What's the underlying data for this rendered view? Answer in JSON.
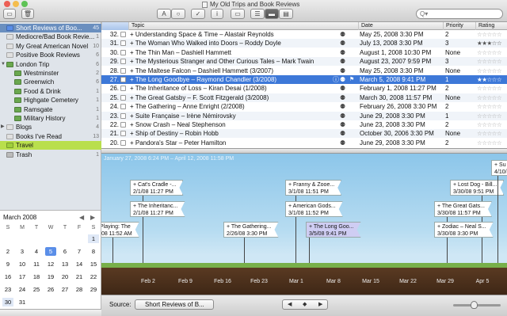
{
  "window": {
    "title": "My Old Trips and Book Reviews",
    "colors": {
      "close": "#ec5f55",
      "minimize": "#f4bd4e",
      "zoom": "#5ec356"
    }
  },
  "toolbar": {
    "text_button": "A",
    "circle_button": "○",
    "check_button": "✓",
    "info_button": "i",
    "search_placeholder": "Q▾"
  },
  "sidebar": {
    "items": [
      {
        "label": "Short Reviews of Boo...",
        "count": "45",
        "selected": true
      },
      {
        "label": "Mediocre/Bad Book Revie...",
        "count": "1"
      },
      {
        "label": "My Great American Novel",
        "count": "10"
      },
      {
        "label": "Positive Book Reviews",
        "count": "6"
      },
      {
        "label": "London Trip",
        "count": "6"
      },
      {
        "label": "Westminster",
        "count": "2"
      },
      {
        "label": "Greenwich",
        "count": "6"
      },
      {
        "label": "Food & Drink",
        "count": "1"
      },
      {
        "label": "Highgate Cemetery",
        "count": "1"
      },
      {
        "label": "Ramsgate",
        "count": "1"
      },
      {
        "label": "Military History",
        "count": "1"
      },
      {
        "label": "Blogs",
        "count": "4"
      },
      {
        "label": "Books I've Read",
        "count": "13"
      },
      {
        "label": "Travel",
        "count": ""
      },
      {
        "label": "Trash",
        "count": "1"
      }
    ]
  },
  "calendar": {
    "title": "March 2008",
    "prev": "◀",
    "next": "▶",
    "weekdays": [
      "S",
      "M",
      "T",
      "W",
      "T",
      "F",
      "S"
    ],
    "weeks": [
      [
        "",
        "",
        "",
        "",
        "",
        "",
        "1"
      ],
      [
        "2",
        "3",
        "4",
        "5",
        "6",
        "7",
        "8"
      ],
      [
        "9",
        "10",
        "11",
        "12",
        "13",
        "14",
        "15"
      ],
      [
        "16",
        "17",
        "18",
        "19",
        "20",
        "21",
        "22"
      ],
      [
        "23",
        "24",
        "25",
        "26",
        "27",
        "28",
        "29"
      ],
      [
        "30",
        "31",
        "",
        "",
        "",
        "",
        ""
      ]
    ],
    "selected_day": "5",
    "highlighted_days": [
      "1",
      "30"
    ]
  },
  "table": {
    "headers": {
      "topic": "Topic",
      "date": "Date",
      "priority": "Priority",
      "rating": "Rating"
    },
    "rows": [
      {
        "num": "32.",
        "topic": "+ Understanding Space & Time – Alastair Reynolds",
        "date": "May 25, 2008 3:30 PM",
        "priority": "2",
        "rating": 0
      },
      {
        "num": "31.",
        "topic": "+ The Woman Who Walked into Doors – Roddy Doyle",
        "date": "July 13, 2008 3:30 PM",
        "priority": "3",
        "rating": 3
      },
      {
        "num": "30.",
        "topic": "+ The Thin Man – Dashiell Hammett",
        "date": "August 1, 2008 10:30 PM",
        "priority": "None",
        "rating": 0
      },
      {
        "num": "29.",
        "topic": "+ The Mysterious Stranger and Other Curious Tales – Mark Twain",
        "date": "August 23, 2007 9:59 PM",
        "priority": "3",
        "rating": 0
      },
      {
        "num": "28.",
        "topic": "+ The Maltese Falcon – Dashiell Hammett (3/2007)",
        "date": "May 25, 2008 3:30 PM",
        "priority": "None",
        "rating": 0
      },
      {
        "num": "27.",
        "topic": "+ The Long Goodbye – Raymond Chandler (3/2008)",
        "date": "March 5, 2008 9:41 PM",
        "priority": "1",
        "rating": 2,
        "selected": true
      },
      {
        "num": "26.",
        "topic": "+ The Inheritance of Loss – Kiran Desai  (1/2008)",
        "date": "February 1, 2008 11:27 PM",
        "priority": "2",
        "rating": 0
      },
      {
        "num": "25.",
        "topic": "+ The Great Gatsby – F. Scott Fitzgerald (3/2008)",
        "date": "March 30, 2008 11:57 PM",
        "priority": "None",
        "rating": 0
      },
      {
        "num": "24.",
        "topic": "+ The Gathering – Anne Enright (2/2008)",
        "date": "February 26, 2008 3:30 PM",
        "priority": "2",
        "rating": 0
      },
      {
        "num": "23.",
        "topic": "+ Suite Française – Irène Némirovsky",
        "date": "June 29, 2008 3:30 PM",
        "priority": "1",
        "rating": 0
      },
      {
        "num": "22.",
        "topic": "+ Snow Crash – Neal Stephenson",
        "date": "June 23, 2008 3:30 PM",
        "priority": "2",
        "rating": 0
      },
      {
        "num": "21.",
        "topic": "+ Ship of Destiny – Robin Hobb",
        "date": "October 30, 2006 3:30 PM",
        "priority": "None",
        "rating": 0
      },
      {
        "num": "20.",
        "topic": "+ Pandora's Star – Peter Hamilton",
        "date": "June 29, 2008 3:30 PM",
        "priority": "2",
        "rating": 0
      }
    ]
  },
  "timeline": {
    "range": "January 27, 2008 6:24 PM – April 12, 2008 11:58 PM",
    "ticks": [
      "Feb 2",
      "Feb 9",
      "Feb 16",
      "Feb 23",
      "Mar 1",
      "Mar 8",
      "Mar 15",
      "Mar 22",
      "Mar 29",
      "Apr 5"
    ],
    "cards": [
      {
        "title": "+ Cat's Cradle -...",
        "date": "2/1/08 11:27 PM"
      },
      {
        "title": "+ The Inheritanc...",
        "date": "2/1/08 11:27 PM"
      },
      {
        "title": "Playing: The",
        "date": "/08 11:52 AM"
      },
      {
        "title": "+ The Gathering...",
        "date": "2/26/08 3:30 PM"
      },
      {
        "title": "+ Franny & Zooe...",
        "date": "3/1/08 11:51 PM"
      },
      {
        "title": "+ American Gods...",
        "date": "3/1/08 11:52 PM"
      },
      {
        "title": "+ The Long Goo...",
        "date": "3/5/08 9:41 PM"
      },
      {
        "title": "+ Lost Dog - Bill...",
        "date": "3/30/08 9:51 PM"
      },
      {
        "title": "+ The Great Gats...",
        "date": "3/30/08 11:57 PM"
      },
      {
        "title": "+ Zodiac – Neal S...",
        "date": "3/30/08 3:30 PM"
      },
      {
        "title": "+ Su",
        "date": "4/10/"
      }
    ]
  },
  "bottombar": {
    "source_label": "Source:",
    "source_value": "Short Reviews of B..."
  }
}
